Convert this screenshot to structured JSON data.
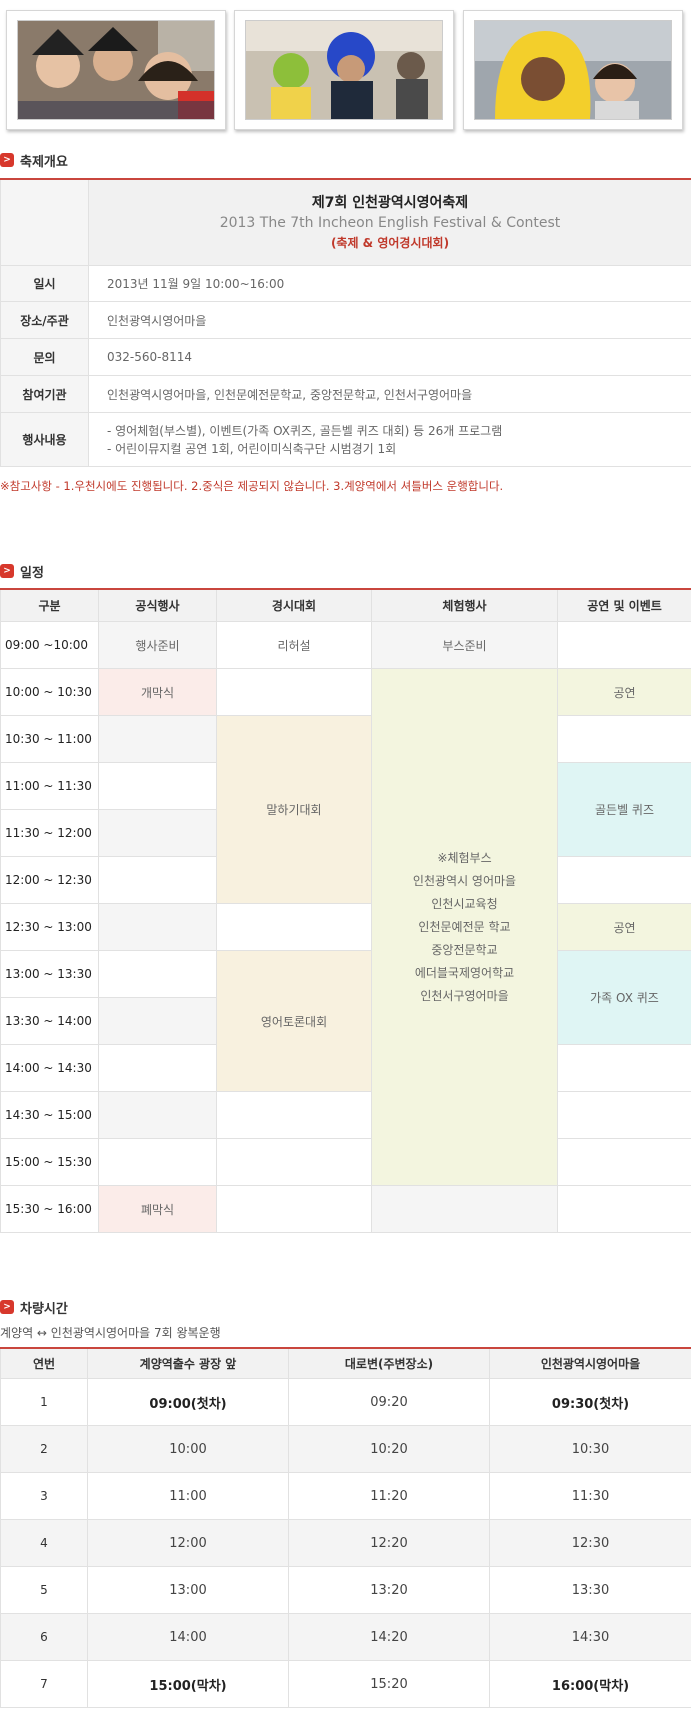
{
  "sections": {
    "overview": "축제개요",
    "schedule": "일정",
    "shuttle": "차량시간"
  },
  "overview": {
    "title": "제7회 인천광역시영어축제",
    "subtitle": "2013 The 7th Incheon English Festival & Contest",
    "subtitle2": "(축제 & 영어경시대회)",
    "rows": [
      {
        "label": "일시",
        "value": "2013년 11월 9일 10:00~16:00"
      },
      {
        "label": "장소/주관",
        "value": "인천광역시영어마을"
      },
      {
        "label": "문의",
        "value": "032-560-8114"
      },
      {
        "label": "참여기관",
        "value": "인천광역시영어마을, 인천문예전문학교, 중앙전문학교, 인천서구영어마을"
      },
      {
        "label": "행사내용",
        "value": "- 영어체험(부스별), 이벤트(가족 OX퀴즈, 골든벨 퀴즈 대회) 등 26개 프로그램",
        "value2": "- 어린이뮤지컬 공연 1회, 어린이미식축구단 시범경기 1회"
      }
    ],
    "note": "※참고사항 - 1.우천시에도 진행됩니다.   2.중식은 제공되지 않습니다.   3.계양역에서 셔틀버스 운행합니다."
  },
  "schedule": {
    "headers": [
      "구분",
      "공식행사",
      "경시대회",
      "체험행사",
      "공연 및 이벤트"
    ],
    "times": [
      "09:00 ~10:00",
      "10:00 ~ 10:30",
      "10:30 ~ 11:00",
      "11:00 ~ 11:30",
      "11:30 ~ 12:00",
      "12:00 ~ 12:30",
      "12:30 ~ 13:00",
      "13:00 ~ 13:30",
      "13:30 ~ 14:00",
      "14:00 ~ 14:30",
      "14:30 ~ 15:00",
      "15:00 ~ 15:30",
      "15:30 ~ 16:00"
    ],
    "prep": "행사준비",
    "rehearsal": "리허설",
    "booth_prep": "부스준비",
    "opening": "개막식",
    "closing": "폐막식",
    "speech": "말하기대회",
    "debate": "영어토론대회",
    "performance1": "공연",
    "goldenbell": "골든벨 퀴즈",
    "performance2": "공연",
    "ox_quiz": "가족 OX 퀴즈",
    "experience": [
      "※체험부스",
      "인천광역시 영어마을",
      "인천시교육청",
      "인천문예전문 학교",
      "중앙전문학교",
      "에더블국제영어학교",
      "인천서구영어마을"
    ]
  },
  "shuttle": {
    "note": "계양역 ↔ 인천광역시영어마을 7회 왕복운행",
    "headers": [
      "연번",
      "계양역출수 광장 앞",
      "대로변(주변장소)",
      "인천광역시영어마을"
    ],
    "rows": [
      [
        "1",
        "09:00(첫차)",
        "09:20",
        "09:30(첫차)"
      ],
      [
        "2",
        "10:00",
        "10:20",
        "10:30"
      ],
      [
        "3",
        "11:00",
        "11:20",
        "11:30"
      ],
      [
        "4",
        "12:00",
        "12:20",
        "12:30"
      ],
      [
        "5",
        "13:00",
        "13:20",
        "13:30"
      ],
      [
        "6",
        "14:00",
        "14:20",
        "14:30"
      ],
      [
        "7",
        "15:00(막차)",
        "15:20",
        "16:00(막차)"
      ]
    ]
  }
}
